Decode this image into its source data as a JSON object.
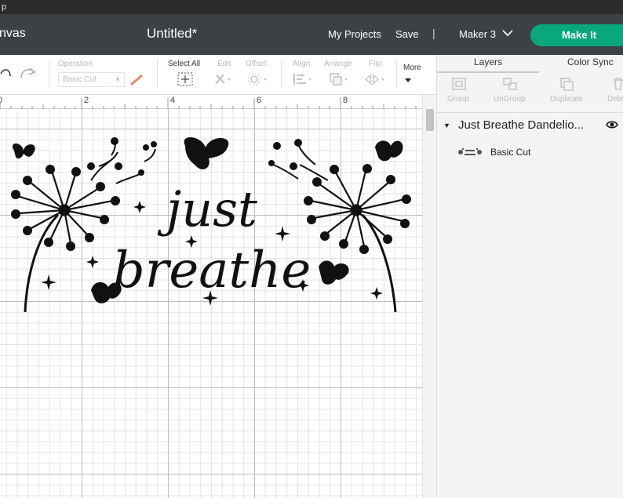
{
  "titlebar": {
    "text": "p"
  },
  "header": {
    "canvas_label": "nvas",
    "doc_title": "Untitled*",
    "my_projects": "My Projects",
    "save": "Save",
    "separator": "|",
    "machine": "Maker 3",
    "make_it": "Make It",
    "make_it_color": "#08a87c"
  },
  "toolbar": {
    "operation_label": "Operation",
    "operation_value": "Basic Cut",
    "select_all": "Select All",
    "edit": "Edit",
    "offset": "Offset",
    "align": "Align",
    "arrange": "Arrange",
    "flip": "Flip",
    "more": "More"
  },
  "ruler": {
    "ticks": [
      "0",
      "2",
      "4",
      "6",
      "8"
    ]
  },
  "design": {
    "line1": "just",
    "line2": "breathe"
  },
  "panel": {
    "tabs": [
      "Layers",
      "Color Sync"
    ],
    "tools": [
      "Group",
      "UnGroup",
      "Duplicate",
      "Dele"
    ],
    "group_name": "Just Breathe Dandelio...",
    "layers": [
      {
        "name": "Basic Cut",
        "icon": "design-thumbnail"
      }
    ]
  }
}
